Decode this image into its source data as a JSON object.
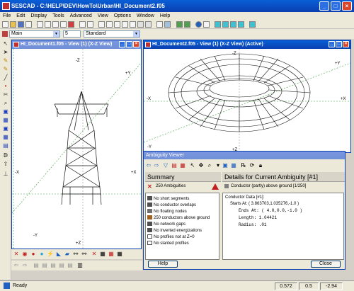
{
  "app": {
    "title": "SESCAD - C:\\HELP\\DEV\\HowTo\\Urban\\HI_Document2.f05"
  },
  "menu": [
    "File",
    "Edit",
    "Display",
    "Tools",
    "Advanced",
    "View",
    "Options",
    "Window",
    "Help"
  ],
  "toolbar2": {
    "layer": "Main",
    "number": "5",
    "style": "Standard"
  },
  "window1": {
    "title": "HI_Document1.f05 - View (1) (X-Z View)",
    "axes": {
      "yplus": "+Y",
      "yminus": "-Y",
      "xminus": "-X",
      "xplus": "+X",
      "zminus": "-Z",
      "zplus": "+Z"
    }
  },
  "window2": {
    "title": "HI_Document2.f05 - View (1) (X-Z View) (Active)",
    "axes": {
      "yminus": "-Y",
      "yplus": "+Y",
      "xminus": "-X",
      "xplus": "+X",
      "zminus": "-Z",
      "zplus": "+Z"
    }
  },
  "dialog": {
    "title": "Ambiguity Viewer",
    "summary_header": "Summary",
    "details_header": "Details for Current Ambiguity [#1]",
    "ambiguity_count": "250 Ambiguities",
    "current_ambiguity": "Conductor (partly) above ground [1/250]",
    "summary_items": [
      "No short segments",
      "No conductor overlaps",
      "No floating nodes",
      "250 conductors above ground",
      "No network gaps",
      "No inverted energizations",
      "No profiles not at Z=0",
      "No slanted profiles"
    ],
    "details": {
      "heading": "Conductor Data [#1]:",
      "starts": "Starts At: ( 3.863703,1.035276,-1.0 )",
      "ends": "Ends At: ( 4.0,0.0,-1.0 )",
      "length": "Length: 1.04421",
      "radius": "Radius: .01"
    },
    "help_label": "Help",
    "close_label": "Close"
  },
  "status": {
    "text": "Ready",
    "x": "0.572",
    "y": "0.5",
    "z": "-2.94"
  }
}
